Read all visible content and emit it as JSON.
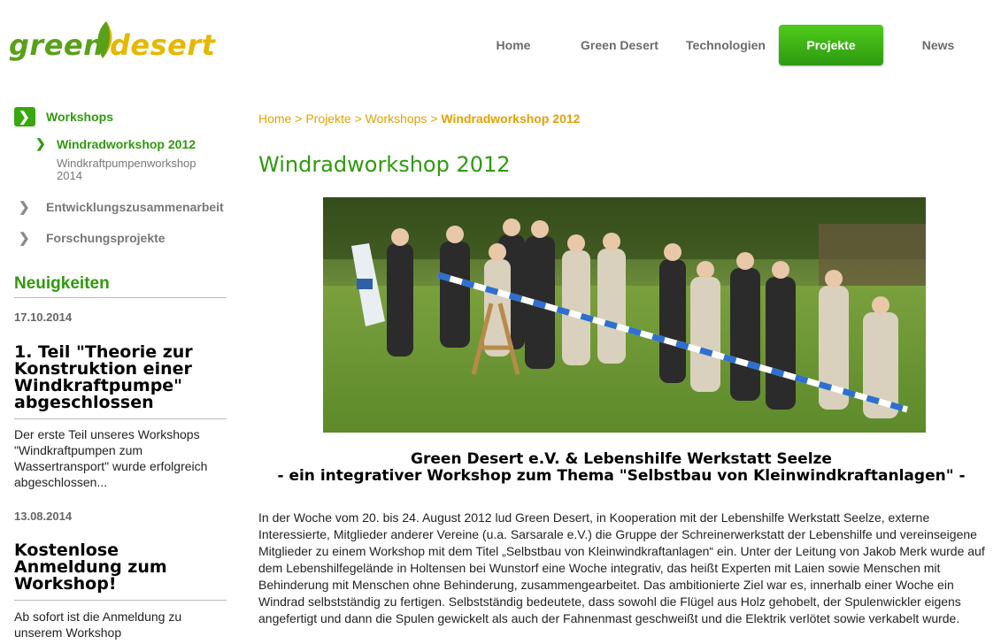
{
  "logo": {
    "part1": "green",
    "part2": "desert"
  },
  "nav": [
    {
      "label": "Home",
      "active": false
    },
    {
      "label": "Green Desert",
      "active": false
    },
    {
      "label": "Technologien",
      "active": false
    },
    {
      "label": "Projekte",
      "active": true
    },
    {
      "label": "News",
      "active": false
    }
  ],
  "sidebar": {
    "items": [
      {
        "label": "Workshops",
        "icon": "chevron-right-icon"
      },
      {
        "label": "Windradworkshop 2012",
        "icon": "chevron-right-icon"
      },
      {
        "label": "Windkraftpumpenworkshop 2014"
      },
      {
        "label": "Entwicklungszusammenarbeit",
        "icon": "chevron-right-icon"
      },
      {
        "label": "Forschungsprojekte",
        "icon": "chevron-right-icon"
      }
    ]
  },
  "news": {
    "title": "Neuigkeiten",
    "entries": [
      {
        "date": "17.10.2014",
        "headline": "1. Teil \"Theorie zur Konstruktion einer Windkraftpumpe\" abgeschlossen",
        "text": "Der erste Teil unseres Workshops \"Windkraftpumpen zum Wassertransport\" wurde erfolgreich abgeschlossen..."
      },
      {
        "date": "13.08.2014",
        "headline": "Kostenlose Anmeldung zum Workshop!",
        "text": "Ab sofort ist die Anmeldung zu unserem Workshop"
      }
    ]
  },
  "breadcrumb": {
    "items": [
      "Home",
      "Projekte",
      "Workshops"
    ],
    "separator": ">",
    "current": "Windradworkshop 2012"
  },
  "main": {
    "title": "Windradworkshop 2012",
    "subtitle_line1": "Green Desert e.V. & Lebenshilfe Werkstatt Seelze",
    "subtitle_line2": "- ein integrativer Workshop zum Thema \"Selbstbau von Kleinwindkraftanlagen\" -",
    "body": "In der Woche vom 20. bis 24. August 2012 lud Green Desert, in Kooperation mit der Lebenshilfe Werkstatt Seelze, externe Interessierte, Mitglieder anderer Vereine (u.a. Sarsarale e.V.) die Gruppe der Schreinerwerkstatt der Lebenshilfe und vereinseigene Mitglieder zu einem Workshop mit dem Titel „Selbstbau von Kleinwindkraftanlagen“ ein. Unter der Leitung von Jakob Merk wurde auf dem Lebenshilfegelände in Holtensen bei Wunstorf eine Woche integrativ, das heißt Experten mit Laien sowie Menschen mit Behinderung mit Menschen ohne Behinderung, zusammengearbeitet. Das ambitionierte Ziel war es, innerhalb einer Woche ein Windrad selbstständig zu fertigen. Selbstständig bedeutete, dass sowohl die Flügel aus Holz gehobelt, der Spulenwickler eigens angefertigt und dann die Spulen gewickelt als auch der Fahnenmast geschweißt und die Elektrik verlötet sowie verkabelt wurde."
  },
  "colors": {
    "green": "#2f9a0d",
    "accent": "#e6a100",
    "nav_active": "#3aa610"
  }
}
